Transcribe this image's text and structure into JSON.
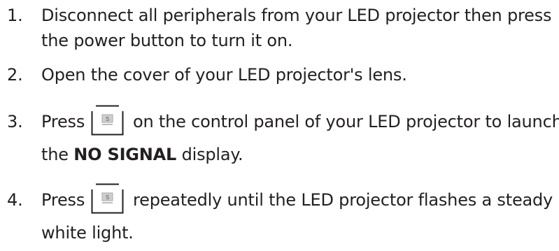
{
  "steps": [
    {
      "number": "1.",
      "line1": "Disconnect all peripherals from your LED projector then press",
      "line2": "the power button to turn it on."
    },
    {
      "number": "2.",
      "line1": "Open the cover of your LED projector's lens."
    },
    {
      "number": "3.",
      "pre_icon": "Press",
      "post_icon": "on the control panel of your LED projector to launch",
      "line2_pre": "the",
      "line2_bold": "NO SIGNAL",
      "line2_post": "display.",
      "icon": "source-button-icon",
      "icon_letter": "S"
    },
    {
      "number": "4.",
      "pre_icon": "Press",
      "post_icon": "repeatedly until the LED projector flashes a steady",
      "line2": "white light.",
      "icon": "source-button-icon",
      "icon_letter": "S"
    }
  ]
}
